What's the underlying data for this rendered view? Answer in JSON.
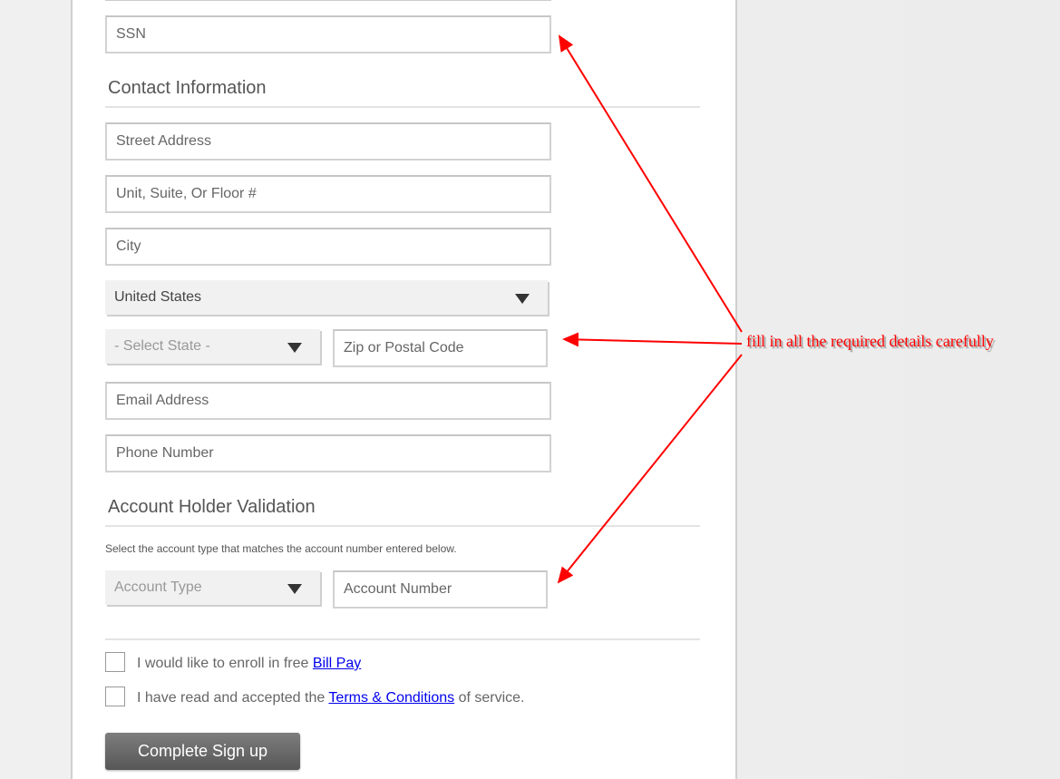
{
  "form": {
    "ssn_placeholder": "SSN",
    "contact_section_title": "Contact Information",
    "street_placeholder": "Street Address",
    "unit_placeholder": "Unit, Suite, Or Floor #",
    "city_placeholder": "City",
    "country_selected": "United States",
    "state_placeholder": "- Select State -",
    "zip_placeholder": "Zip or Postal Code",
    "email_placeholder": "Email Address",
    "phone_placeholder": "Phone Number",
    "validation_section_title": "Account Holder Validation",
    "validation_help": "Select the account type that matches the account number entered below.",
    "account_type_placeholder": "Account Type",
    "account_number_placeholder": "Account Number",
    "billpay_text": "I would like to enroll in free ",
    "billpay_link": "Bill Pay",
    "terms_text_before": "I have read and accepted the ",
    "terms_link": "Terms & Conditions",
    "terms_text_after": " of service.",
    "submit_label": "Complete Sign up"
  },
  "annotation": {
    "text": "fill in all the required details carefully",
    "color": "#ff0000"
  }
}
